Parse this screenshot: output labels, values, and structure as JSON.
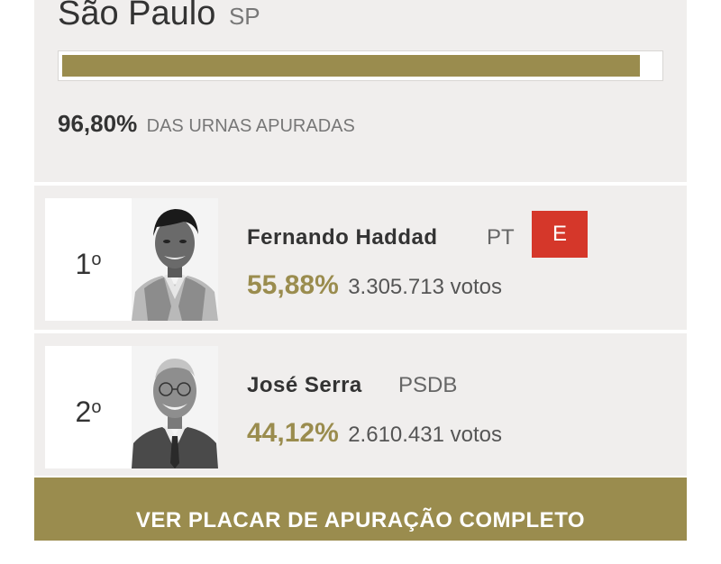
{
  "header": {
    "city": "São Paulo",
    "state": "SP",
    "progress_fraction": 0.968,
    "counted_percent": "96,80%",
    "counted_label": "DAS URNAS APURADAS"
  },
  "candidates": [
    {
      "rank_number": "1",
      "rank_suffix": "o",
      "name": "Fernando Haddad",
      "party": "PT",
      "elected_badge": "E",
      "percent": "55,88%",
      "votes": "3.305.713 votos"
    },
    {
      "rank_number": "2",
      "rank_suffix": "o",
      "name": "José Serra",
      "party": "PSDB",
      "percent": "44,12%",
      "votes": "2.610.431 votos"
    }
  ],
  "cta": {
    "label": "VER PLACAR DE APURAÇÃO COMPLETO"
  },
  "colors": {
    "accent": "#9a8c4e",
    "elected": "#d5372a",
    "panel": "#f0eeed"
  }
}
